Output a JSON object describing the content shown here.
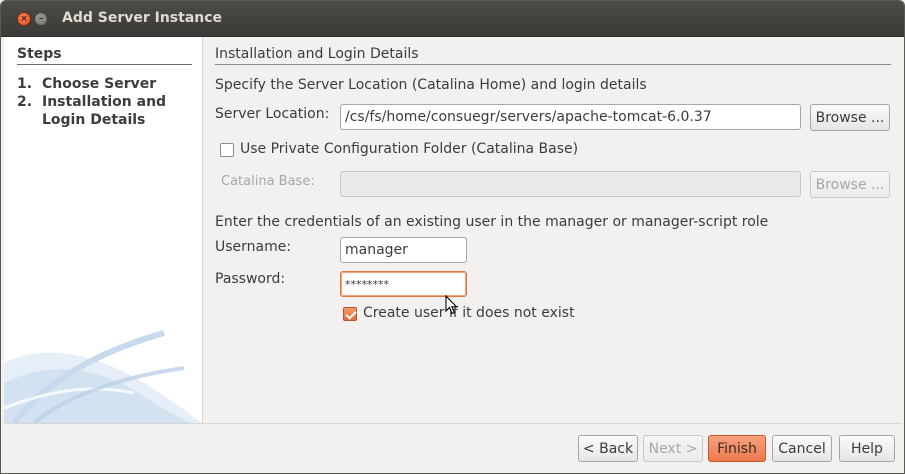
{
  "window": {
    "title": "Add Server Instance"
  },
  "steps": {
    "title": "Steps",
    "items": [
      {
        "num": "1.",
        "label": "Choose Server"
      },
      {
        "num": "2.",
        "label": "Installation and Login Details"
      }
    ]
  },
  "section": {
    "title": "Installation and Login Details",
    "intro": "Specify the Server Location (Catalina Home) and login details"
  },
  "server_location": {
    "label": "Server Location:",
    "value": "/cs/fs/home/consuegr/servers/apache-tomcat-6.0.37",
    "browse_label": "Browse ..."
  },
  "private_config": {
    "label": "Use Private Configuration Folder (Catalina Base)",
    "checked": false
  },
  "catalina_base": {
    "label": "Catalina Base:",
    "value": "",
    "browse_label": "Browse ..."
  },
  "credentials": {
    "intro": "Enter the credentials of an existing user in the manager or manager-script role",
    "username_label": "Username:",
    "username_value": "manager",
    "password_label": "Password:",
    "password_value": "********",
    "create_user_label": "Create user if it does not exist",
    "create_user_checked": true
  },
  "buttons": {
    "back": "< Back",
    "next": "Next >",
    "finish": "Finish",
    "cancel": "Cancel",
    "help": "Help"
  },
  "colors": {
    "accent": "#ec7a4d",
    "titlebar": "#3c3b37"
  }
}
